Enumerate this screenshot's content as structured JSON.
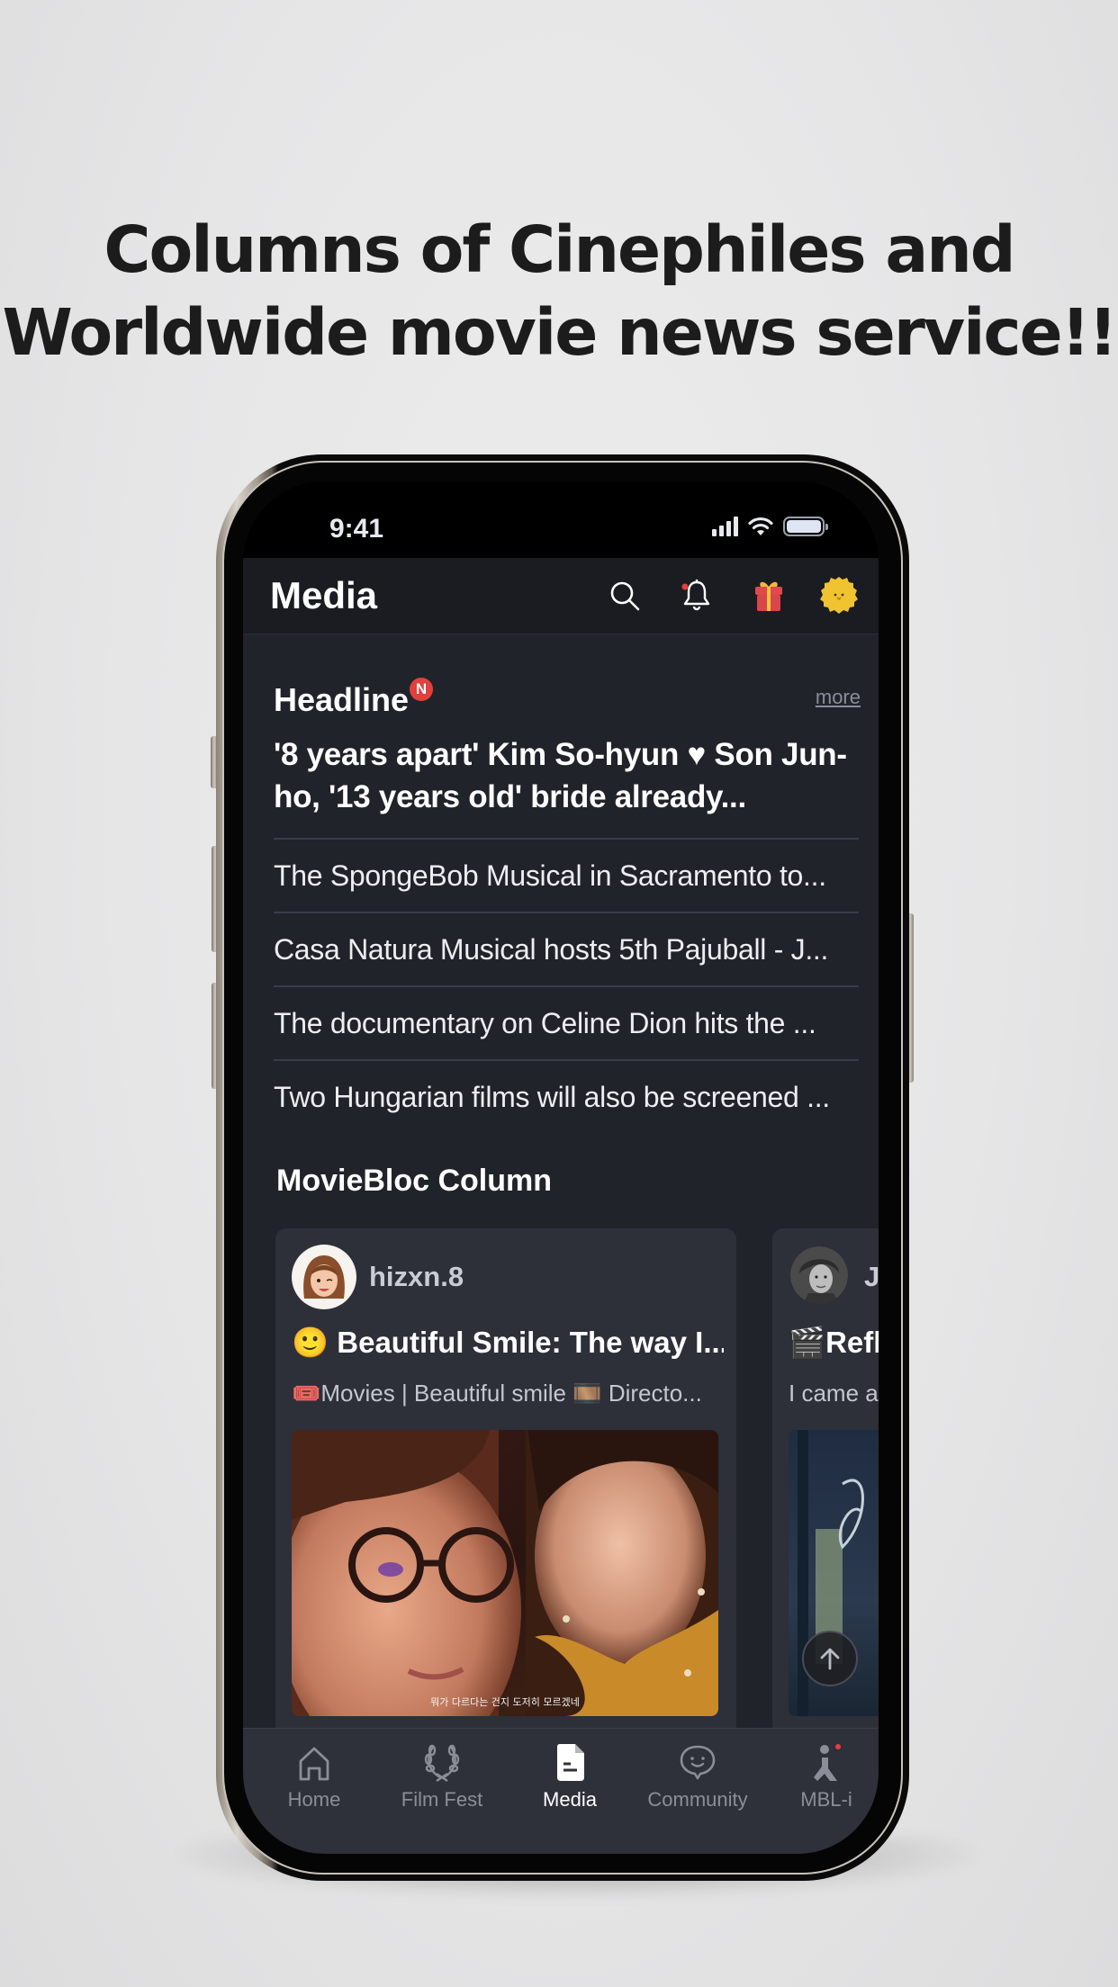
{
  "promo": {
    "line1": "Columns of Cinephiles and",
    "line2": "Worldwide movie news service!!"
  },
  "status_bar": {
    "time": "9:41",
    "icons": [
      "cellular-signal-icon",
      "wifi-icon",
      "battery-icon"
    ]
  },
  "header": {
    "title": "Media",
    "icons": [
      "search-icon",
      "bell-icon",
      "gift-icon",
      "profile-avatar-icon"
    ],
    "bell_has_notification": true
  },
  "headline": {
    "heading": "Headline",
    "badge": "N",
    "more_label": "more",
    "main_title": "'8 years apart' Kim So-hyun ♥ Son Jun-ho, '13 years old' bride already...",
    "items": [
      "The SpongeBob Musical in Sacramento to...",
      "Casa Natura Musical hosts 5th Pajuball - J...",
      "The documentary on Celine Dion hits the ...",
      "Two Hungarian films will also be screened ..."
    ]
  },
  "column": {
    "heading": "MovieBloc Column",
    "cards": [
      {
        "author": "hizxn.8",
        "title": "🙂 Beautiful Smile: The way I...",
        "description": "🎟️Movies | Beautiful smile 🎞️ Directo...",
        "thumbnail_subtitle": "뭐가 다르다는 건지 도저히 모르겠네"
      },
      {
        "author": "J",
        "title": "🎬Refl",
        "description": "I came a"
      }
    ]
  },
  "scroll_top_icon": "arrow-up-icon",
  "tabbar": {
    "active": "Media",
    "tabs": [
      {
        "label": "Home",
        "icon": "home-icon"
      },
      {
        "label": "Film Fest",
        "icon": "laurel-icon"
      },
      {
        "label": "Media",
        "icon": "document-icon"
      },
      {
        "label": "Community",
        "icon": "chat-smile-icon"
      },
      {
        "label": "MBL-i",
        "icon": "mbl-i-icon"
      }
    ]
  },
  "colors": {
    "accent_red": "#e2403b",
    "gift_red": "#d9464a",
    "avatar_yellow": "#f0c330",
    "screen_bg": "#21232b",
    "card_bg": "#2d2f39"
  }
}
